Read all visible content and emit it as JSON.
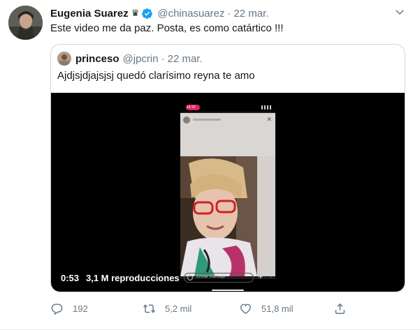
{
  "tweet": {
    "display_name": "Eugenia Suarez",
    "crown": "♛",
    "handle": "@chinasuarez",
    "separator": "·",
    "timestamp": "22 mar.",
    "text": "Este video me da paz. Posta, es como catártico !!!"
  },
  "quoted": {
    "display_name": "princeso",
    "handle": "@jpcrin",
    "separator": "·",
    "timestamp": "22 mar.",
    "text": "Ajdjsjdjajsjsj quedó clarísimo reyna te amo"
  },
  "video": {
    "recording_time": "14:16",
    "duration": "0:53",
    "views": "3,1 M reproducciones",
    "dm_placeholder": "Enviar mensaje"
  },
  "actions": {
    "reply_count": "192",
    "retweet_count": "5,2 mil",
    "like_count": "51,8 mil"
  },
  "colors": {
    "text_primary": "#14171a",
    "text_secondary": "#657786",
    "verified_blue": "#1da1f2",
    "border": "#ccd6dd",
    "video_bg": "#000000"
  },
  "icons": [
    "verified-badge-icon",
    "chevron-down-icon",
    "reply-icon",
    "retweet-icon",
    "like-icon",
    "share-icon"
  ]
}
